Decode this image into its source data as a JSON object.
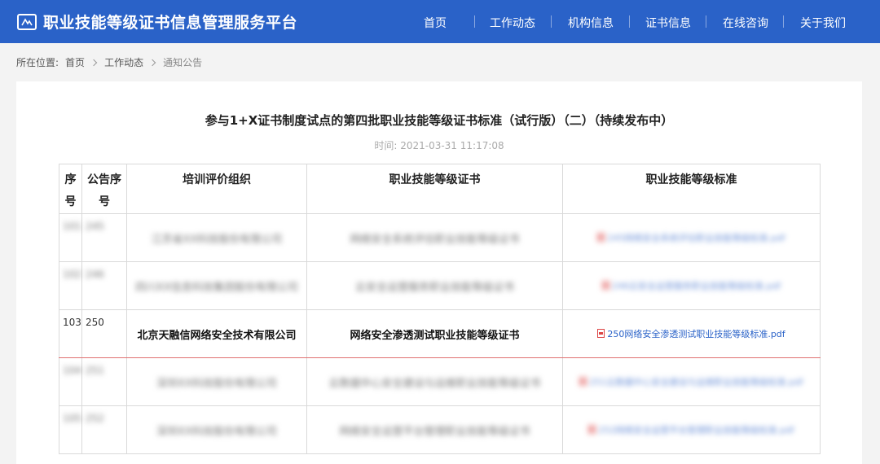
{
  "header": {
    "brand": "职业技能等级证书信息管理服务平台",
    "nav": [
      "首页",
      "工作动态",
      "机构信息",
      "证书信息",
      "在线咨询",
      "关于我们"
    ]
  },
  "breadcrumb": {
    "prefix": "所在位置:",
    "items": [
      "首页",
      "工作动态",
      "通知公告"
    ]
  },
  "article": {
    "title": "参与1+X证书制度试点的第四批职业技能等级证书标准（试行版）（二）（持续发布中）",
    "time": "时间:   2021-03-31 11:17:08"
  },
  "table": {
    "headers": [
      "序号",
      "公告序号",
      "培训评价组织",
      "职业技能等级证书",
      "职业技能等级标准"
    ],
    "rows": [
      {
        "seq": "101",
        "pub": "245",
        "org": "江苏省XX科技股份有限公司",
        "cert": "网络安全系统评估职业技能等级证书",
        "std": "245网络安全系统评估职业技能等级标准.pdf",
        "blurred": true
      },
      {
        "seq": "102",
        "pub": "246",
        "org": "四川XX信息科技集团股份有限公司",
        "cert": "云安全运营服务职业技能等级证书",
        "std": "246云安全运营服务职业技能等级标准.pdf",
        "blurred": true
      },
      {
        "seq": "103",
        "pub": "250",
        "org": "北京天融信网络安全技术有限公司",
        "cert": "网络安全渗透测试职业技能等级证书",
        "std": "250网络安全渗透测试职业技能等级标准.pdf",
        "blurred": false
      },
      {
        "seq": "104",
        "pub": "251",
        "org": "深圳XX科技股份有限公司",
        "cert": "云数据中心安全建设与运维职业技能等级证书",
        "std": "251云数据中心安全建设与运维职业技能等级标准.pdf",
        "blurred": true
      },
      {
        "seq": "105",
        "pub": "252",
        "org": "深圳XX科技股份有限公司",
        "cert": "网络安全运营平台管理职业技能等级证书",
        "std": "252网络安全运营平台管理职业技能等级标准.pdf",
        "blurred": true
      }
    ]
  },
  "colors": {
    "header_bg": "#2a62c8",
    "link": "#2a62c8",
    "highlight_border": "#e07070"
  }
}
